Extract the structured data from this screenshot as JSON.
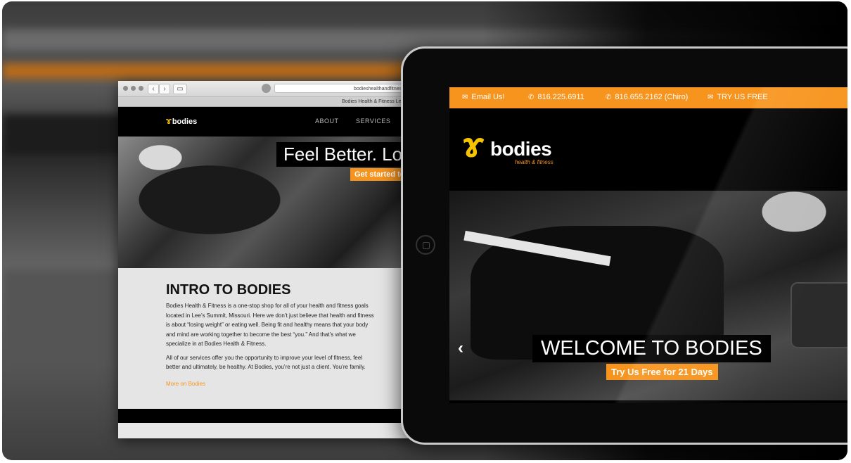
{
  "laptop": {
    "url": "bodieshealthandfitnes",
    "tab_title": "Bodies Health & Fitness Lee's",
    "logo_text": "bodies",
    "nav": [
      "ABOUT",
      "SERVICES"
    ],
    "hero_headline": "Feel Better. Lo",
    "hero_cta": "Get started to",
    "intro_title": "INTRO TO BODIES",
    "intro_p1": "Bodies Health & Fitness is a one-stop shop for all of your health and fitness goals located in Lee’s Summit, Missouri. Here we don’t just believe that health and fitness is about “losing weight” or eating well. Being fit and healthy means that your body and mind are working together to become the best “you.” And that’s what we specialize in at Bodies Health & Fitness.",
    "intro_p2": "All of our services offer you the opportunity to improve your level of fitness, feel better and ultimately, be healthy. At Bodies, you’re not just a client. You’re family.",
    "more_link": "More on Bodies"
  },
  "tablet": {
    "topbar": [
      {
        "icon": "mail-icon",
        "glyph": "✉",
        "label": "Email Us!"
      },
      {
        "icon": "phone-icon",
        "glyph": "✆",
        "label": "816.225.6911"
      },
      {
        "icon": "phone-icon",
        "glyph": "✆",
        "label": "816.655.2162 (Chiro)"
      },
      {
        "icon": "mail-icon",
        "glyph": "✉",
        "label": "TRY US FREE"
      }
    ],
    "logo_word": "bodies",
    "logo_sub": "health & fitness",
    "welcome": "WELCOME TO BODIES",
    "try_btn": "Try Us Free for 21 Days",
    "prev_glyph": "‹"
  },
  "colors": {
    "accent": "#f7941d",
    "logo_yellow": "#f5c400"
  }
}
